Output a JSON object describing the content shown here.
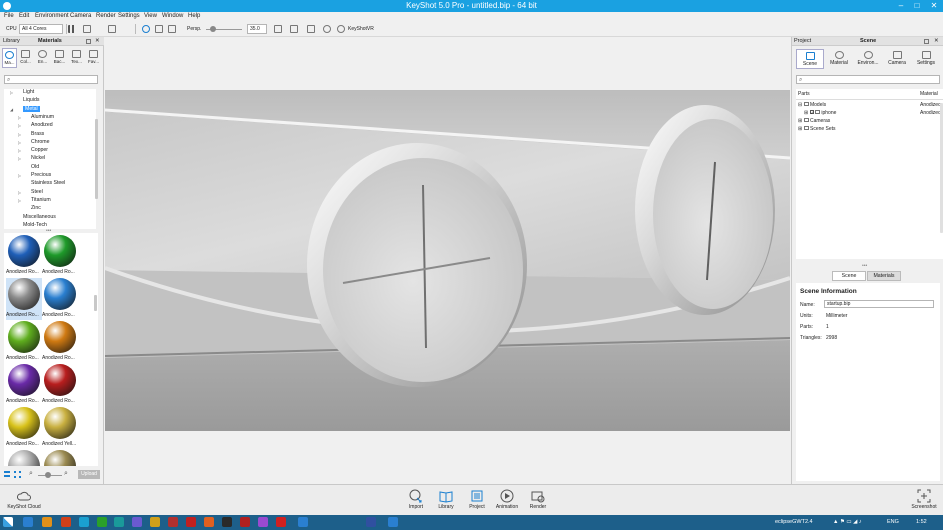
{
  "window": {
    "title": "KeyShot 5.0 Pro  - untitled.bip  - 64 bit",
    "controls": {
      "minimize": "–",
      "maximize": "□",
      "close": "✕"
    }
  },
  "menu": [
    "File",
    "Edit",
    "Environment",
    "Camera",
    "Render",
    "Settings",
    "View",
    "Window",
    "Help"
  ],
  "toolbar": {
    "cpu_label": "CPU",
    "cores_value": "All 4 Cores",
    "persp_label": "Persp.",
    "fov_value": "35.0",
    "keyshotvr_label": "KeyShotVR"
  },
  "library": {
    "panel_left": "Library",
    "panel_title": "Materials",
    "tabs": [
      "Ma...",
      "Col...",
      "En...",
      "Bac...",
      "Tex...",
      "Fav..."
    ],
    "tree": [
      {
        "label": "Light",
        "indent": 0,
        "arrow": "▷"
      },
      {
        "label": "Liquids",
        "indent": 0,
        "arrow": ""
      },
      {
        "label": "Metal",
        "indent": 0,
        "arrow": "◢",
        "selected": true
      },
      {
        "label": "Aluminum",
        "indent": 1,
        "arrow": "▷"
      },
      {
        "label": "Anodized",
        "indent": 1,
        "arrow": "▷"
      },
      {
        "label": "Brass",
        "indent": 1,
        "arrow": "▷"
      },
      {
        "label": "Chrome",
        "indent": 1,
        "arrow": "▷"
      },
      {
        "label": "Copper",
        "indent": 1,
        "arrow": "▷"
      },
      {
        "label": "Nickel",
        "indent": 1,
        "arrow": "▷"
      },
      {
        "label": "Old",
        "indent": 1,
        "arrow": ""
      },
      {
        "label": "Precious",
        "indent": 1,
        "arrow": "▷"
      },
      {
        "label": "Stainless Steel",
        "indent": 1,
        "arrow": ""
      },
      {
        "label": "Steel",
        "indent": 1,
        "arrow": "▷"
      },
      {
        "label": "Titanium",
        "indent": 1,
        "arrow": "▷"
      },
      {
        "label": "Zinc",
        "indent": 1,
        "arrow": ""
      },
      {
        "label": "Miscellaneous",
        "indent": 0,
        "arrow": ""
      },
      {
        "label": "Mold-Tech",
        "indent": 0,
        "arrow": ""
      }
    ],
    "swatches": [
      {
        "label": "Anodized Ro...",
        "color": "#1f5fb8"
      },
      {
        "label": "Anodized Ro...",
        "color": "#1e9a2a"
      },
      {
        "label": "Anodized Ro...",
        "color": "#8c8c8c",
        "selected": true
      },
      {
        "label": "Anodized Ro...",
        "color": "#2a7fd0"
      },
      {
        "label": "Anodized Ro...",
        "color": "#5fae1e"
      },
      {
        "label": "Anodized Ro...",
        "color": "#d07a12"
      },
      {
        "label": "Anodized Ro...",
        "color": "#6a2aa8"
      },
      {
        "label": "Anodized Ro...",
        "color": "#b81e1e"
      },
      {
        "label": "Anodized Ro...",
        "color": "#d8c21a"
      },
      {
        "label": "Anodized Yell...",
        "color": "#c9b040"
      },
      {
        "label": "",
        "color": "#b0b0b0"
      },
      {
        "label": "",
        "color": "#9a8a50"
      }
    ],
    "upload_label": "Upload"
  },
  "scene": {
    "panel_left": "Project",
    "panel_title": "Scene",
    "tabs": [
      "Scene",
      "Material",
      "Environ...",
      "Camera",
      "Settings"
    ],
    "tree_headers": {
      "parts": "Parts",
      "material": "Material"
    },
    "tree": [
      {
        "label": "Models",
        "material": "Anodizec"
      },
      {
        "label": "iphone",
        "material": "Anodizec"
      },
      {
        "label": "Cameras",
        "material": ""
      },
      {
        "label": "Scene Sets",
        "material": ""
      }
    ],
    "subtabs": [
      "Scene",
      "Materials"
    ],
    "info": {
      "title": "Scene Information",
      "name_label": "Name:",
      "name_value": "startup.bip",
      "units_label": "Units:",
      "units_value": "Millimeter",
      "parts_label": "Parts:",
      "parts_value": "1",
      "triangles_label": "Triangles:",
      "triangles_value": "2998"
    }
  },
  "dock": {
    "cloud": "KeyShot Cloud",
    "buttons": [
      "Import",
      "Library",
      "Project",
      "Animation",
      "Render"
    ],
    "screenshot": "Screenshot"
  },
  "taskbar": {
    "tray_text": "eclipseGWT2.4",
    "lang": "ENG",
    "time": "1:52",
    "icon_colors": [
      "#2a7fd0",
      "#e0901a",
      "#d0401a",
      "#1aa0d0",
      "#2aa02a",
      "#1a9a9a",
      "#6a5ad0",
      "#d0a01a",
      "#b03030",
      "#c02020",
      "#e06020",
      "#2a2a2a",
      "#b02020",
      "#9a4ad0",
      "#d02020",
      "#2a7fd0",
      "#3050a0",
      "#2a7fd0"
    ]
  },
  "colors": {
    "accent": "#1aa1e1",
    "selection": "#3399ff",
    "taskbar": "#1d5f8a"
  }
}
